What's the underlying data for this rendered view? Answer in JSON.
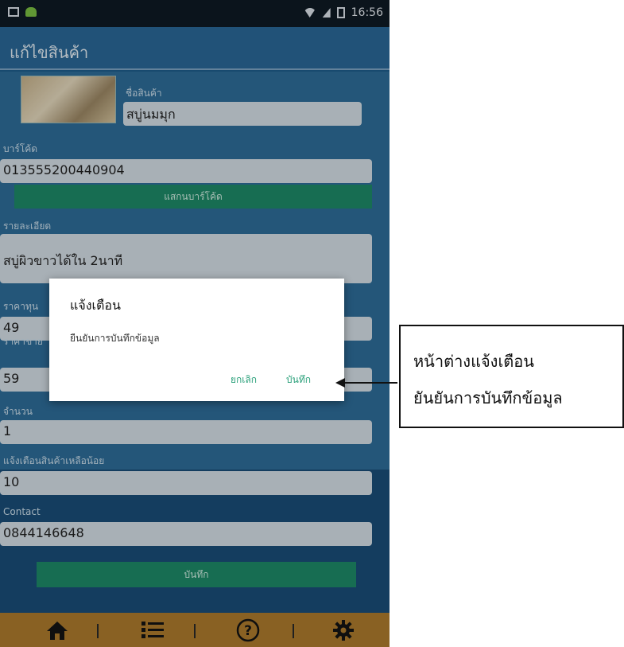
{
  "status_bar": {
    "time": "16:56"
  },
  "title_bar": {
    "title": "แก้ไขสินค้า"
  },
  "form": {
    "name_label": "ชื่อสินค้า",
    "name_value": "สบู่นมมุก",
    "barcode_label": "บาร์โค้ด",
    "barcode_value": "013555200440904",
    "scan_button": "แสกนบาร์โค้ด",
    "detail_label": "รายละเอียด",
    "detail_value": "สบู่ผิวขาวได้ใน 2นาที",
    "cost_label": "ราคาทุน",
    "cost_value": "49",
    "price_label": "ราคาขาย",
    "price_value": "59",
    "qty_label": "จำนวน",
    "qty_value": "1",
    "low_stock_label": "แจ้งเตือนสินค้าเหลือน้อย",
    "low_stock_value": "10",
    "contact_label": "Contact",
    "contact_value": "0844146648",
    "save_button": "บันทึก"
  },
  "dialog": {
    "title": "แจ้งเตือน",
    "message": "ยืนยันการบันทึกข้อมูล",
    "cancel": "ยกเลิก",
    "confirm": "บันทึก"
  },
  "callout": {
    "line1": "หน้าต่างแจ้งเตือน",
    "line2": "ยันยันการบันทึกข้อมูล"
  },
  "nav": [
    "home-icon",
    "list-icon",
    "help-icon",
    "settings-icon"
  ],
  "colors": {
    "app_bg": "#1f5f8f",
    "accent_green": "#1e8c6a",
    "navbar": "#b07d2e",
    "dialog_button": "#2aa07a"
  }
}
